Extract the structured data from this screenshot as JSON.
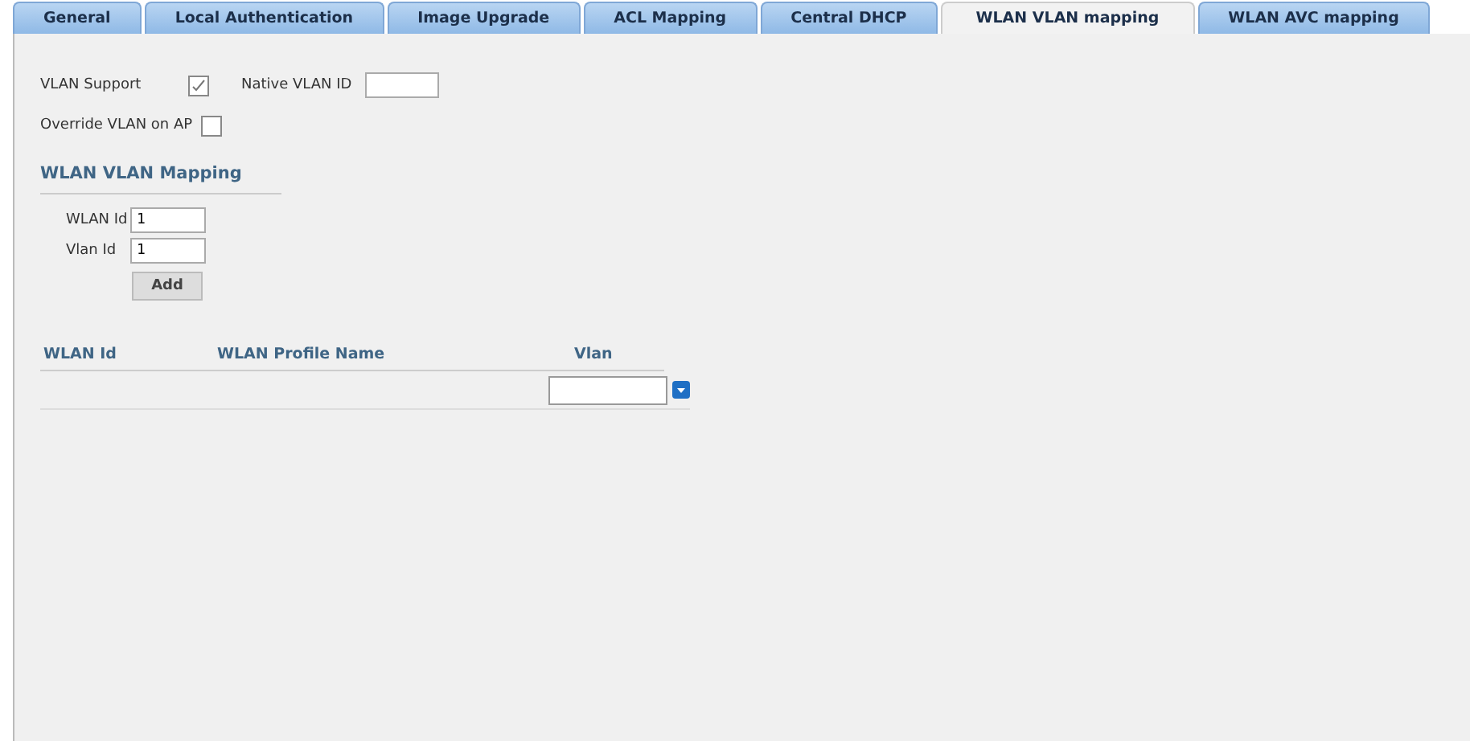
{
  "tabs": [
    {
      "label": "General",
      "selected": false
    },
    {
      "label": "Local Authentication",
      "selected": false
    },
    {
      "label": "Image Upgrade",
      "selected": false
    },
    {
      "label": "ACL Mapping",
      "selected": false
    },
    {
      "label": "Central DHCP",
      "selected": false
    },
    {
      "label": "WLAN VLAN mapping",
      "selected": true
    },
    {
      "label": "WLAN AVC mapping",
      "selected": false
    }
  ],
  "vlan_support": {
    "label": "VLAN Support",
    "checked": true
  },
  "native_vlan_id": {
    "label": "Native VLAN ID"
  },
  "override_vlan": {
    "label": "Override VLAN on AP",
    "checked": false
  },
  "mapping": {
    "heading": "WLAN VLAN Mapping",
    "wlan_id": {
      "label": "WLAN Id",
      "value": "1"
    },
    "vlan_id": {
      "label": "Vlan Id",
      "value": "1"
    },
    "add_button": "Add"
  },
  "table": {
    "columns": [
      "WLAN Id",
      "WLAN Profile Name",
      "Vlan"
    ]
  }
}
